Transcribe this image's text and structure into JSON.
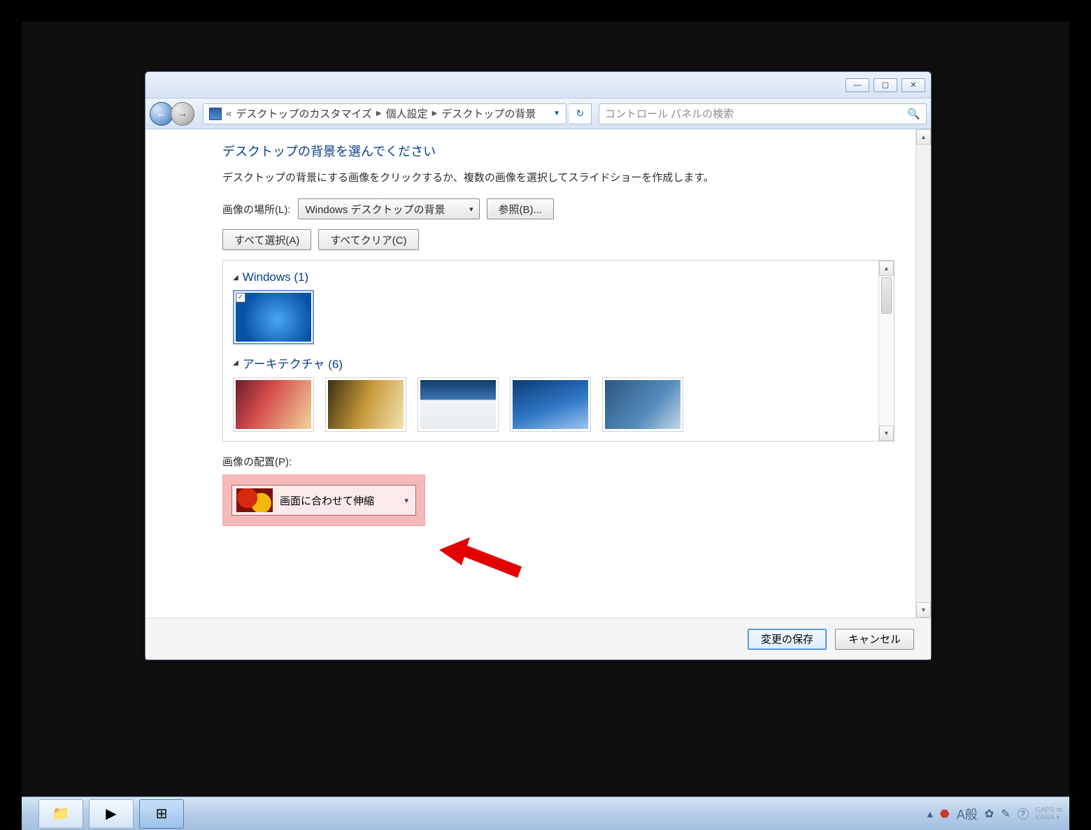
{
  "breadcrumb": {
    "prefix": "«",
    "seg1": "デスクトップのカスタマイズ",
    "seg2": "個人設定",
    "seg3": "デスクトップの背景"
  },
  "search": {
    "placeholder": "コントロール パネルの検索"
  },
  "heading": "デスクトップの背景を選んでください",
  "description": "デスクトップの背景にする画像をクリックするか、複数の画像を選択してスライドショーを作成します。",
  "location": {
    "label": "画像の場所(L):",
    "value": "Windows デスクトップの背景",
    "browse": "参照(B)..."
  },
  "select_all": "すべて選択(A)",
  "clear_all": "すべてクリア(C)",
  "groups": {
    "g1": "Windows (1)",
    "g2": "アーキテクチャ (6)"
  },
  "position": {
    "label": "画像の配置(P):",
    "value": "画面に合わせて伸縮"
  },
  "footer": {
    "save": "変更の保存",
    "cancel": "キャンセル"
  },
  "ime": {
    "mode": "A",
    "mode2": "般",
    "caps": "CAPS",
    "kana": "KANA"
  }
}
